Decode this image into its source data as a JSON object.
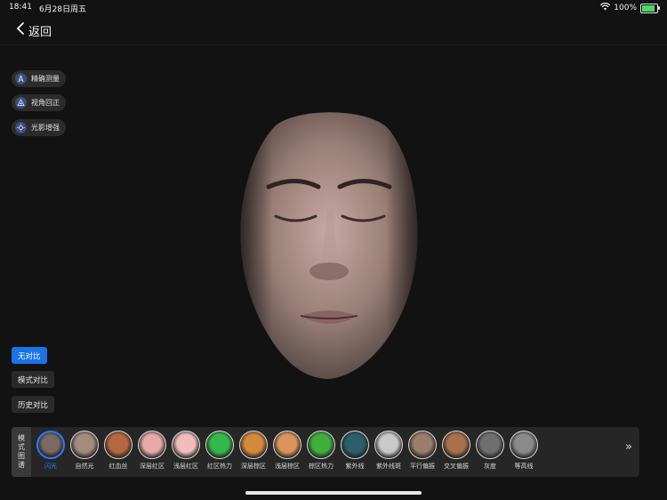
{
  "status": {
    "time": "18:41",
    "date": "6月28日周五",
    "battery": "100%"
  },
  "nav": {
    "back_label": "返回"
  },
  "tools": [
    {
      "label": "精确测量",
      "icon": "measure-icon"
    },
    {
      "label": "视角回正",
      "icon": "view-reset-icon"
    },
    {
      "label": "光影增强",
      "icon": "light-enhance-icon"
    }
  ],
  "compare": [
    {
      "label": "无对比",
      "active": true
    },
    {
      "label": "模式对比",
      "active": false
    },
    {
      "label": "历史对比",
      "active": false
    }
  ],
  "mode_panel": {
    "tab_label": "模式图谱",
    "items": [
      {
        "label": "闪光",
        "selected": true,
        "color": "#7a6a62"
      },
      {
        "label": "自然光",
        "selected": false,
        "color": "#a58b7b"
      },
      {
        "label": "红血丝",
        "selected": false,
        "color": "#b5683f"
      },
      {
        "label": "深层红区",
        "selected": false,
        "color": "#e7a8a8"
      },
      {
        "label": "浅层红区",
        "selected": false,
        "color": "#f0bcbc"
      },
      {
        "label": "红区热力",
        "selected": false,
        "color": "#35b84a"
      },
      {
        "label": "深层棕区",
        "selected": false,
        "color": "#d28a3c"
      },
      {
        "label": "浅层棕区",
        "selected": false,
        "color": "#d9955a"
      },
      {
        "label": "棕区热力",
        "selected": false,
        "color": "#3fae3c"
      },
      {
        "label": "紫外线",
        "selected": false,
        "color": "#2d5e6b"
      },
      {
        "label": "紫外线斑",
        "selected": false,
        "color": "#c9c9c9"
      },
      {
        "label": "平行偏振",
        "selected": false,
        "color": "#9a7d6c"
      },
      {
        "label": "交叉偏振",
        "selected": false,
        "color": "#a86f4c"
      },
      {
        "label": "灰度",
        "selected": false,
        "color": "#6f6f6f"
      },
      {
        "label": "等高线",
        "selected": false,
        "color": "#8a8a8a"
      }
    ],
    "more": "»"
  }
}
